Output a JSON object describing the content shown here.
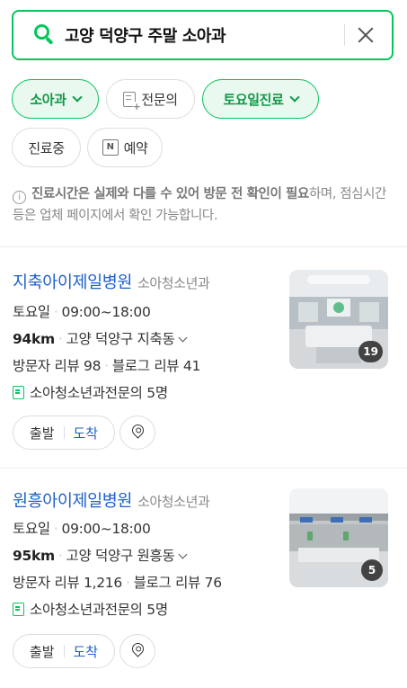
{
  "search": {
    "query": "고양 덕양구 주말 소아과"
  },
  "filters": [
    {
      "label": "소아과",
      "active": true
    },
    {
      "label": "전문의",
      "active": false
    },
    {
      "label": "토요일진료",
      "active": true
    },
    {
      "label": "진료중",
      "active": false
    },
    {
      "label": "예약",
      "active": false
    }
  ],
  "notice": {
    "bold": "진료시간은 실제와 다를 수 있어 방문 전 확인이 필요",
    "rest": "하며, 점심시간 등은 업체 페이지에서 확인 가능합니다."
  },
  "results": [
    {
      "name": "지축아이제일병원",
      "category": "소아청소년과",
      "day": "토요일",
      "hours": "09:00~18:00",
      "distance": "94km",
      "address": "고양 덕양구 지축동",
      "visitor_reviews": "방문자 리뷰 98",
      "blog_reviews": "블로그 리뷰 41",
      "specialists": "소아청소년과전문의 5명",
      "photo_count": "19",
      "depart_label": "출발",
      "arrive_label": "도착"
    },
    {
      "name": "원흥아이제일병원",
      "category": "소아청소년과",
      "day": "토요일",
      "hours": "09:00~18:00",
      "distance": "95km",
      "address": "고양 덕양구 원흥동",
      "visitor_reviews": "방문자 리뷰 1,216",
      "blog_reviews": "블로그 리뷰 76",
      "specialists": "소아청소년과전문의 5명",
      "photo_count": "5",
      "depart_label": "출발",
      "arrive_label": "도착"
    }
  ],
  "colors": {
    "accent": "#03c75a",
    "link": "#1e61c9"
  }
}
